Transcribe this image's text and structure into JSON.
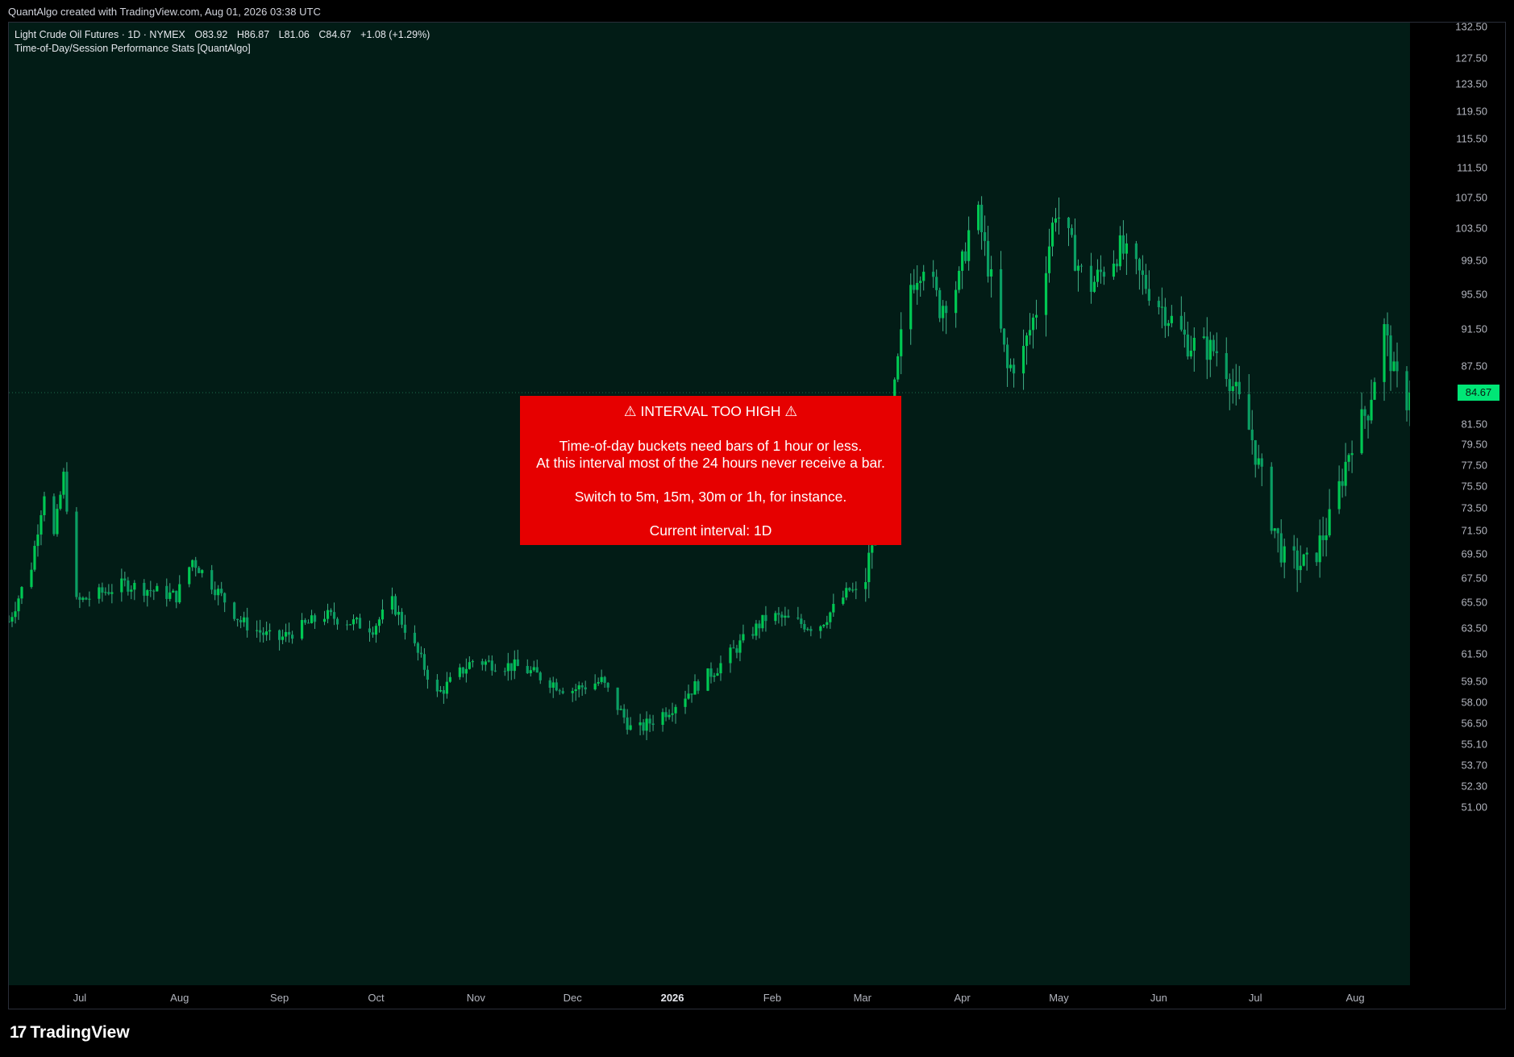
{
  "header": {
    "attribution": "QuantAlgo created with TradingView.com, Aug 01, 2026 03:38 UTC"
  },
  "legend": {
    "symbol": "Light Crude Oil Futures · 1D · NYMEX",
    "open": "O83.92",
    "high": "H86.87",
    "low": "L81.06",
    "close": "C84.67",
    "change": "+1.08 (+1.29%)",
    "indicator": "Time-of-Day/Session Performance Stats [QuantAlgo]"
  },
  "warning": {
    "title": "⚠  INTERVAL TOO HIGH  ⚠",
    "line1": "Time-of-day buckets need bars of 1 hour or less.",
    "line2": "At this interval most of the 24 hours never receive a bar.",
    "line3": "Switch to 5m, 15m, 30m or 1h, for instance.",
    "line4": "Current interval: 1D"
  },
  "brand": {
    "name": "TradingView",
    "logo": "17"
  },
  "colors": {
    "up": "#26a69a",
    "down": "#26a69a",
    "bull_body": "#00c853",
    "bear_body": "#0a9e63",
    "background": "#021c16",
    "price_label": "#00e676",
    "warning_bg": "#e60000"
  },
  "chart_data": {
    "type": "candlestick",
    "current_price": "84.67",
    "y_ticks": [
      "132.50",
      "127.50",
      "123.50",
      "119.50",
      "115.50",
      "111.50",
      "107.50",
      "103.50",
      "99.50",
      "95.50",
      "91.50",
      "87.50",
      "81.50",
      "79.50",
      "77.50",
      "75.50",
      "73.50",
      "71.50",
      "69.50",
      "67.50",
      "65.50",
      "63.50",
      "61.50",
      "59.50",
      "58.00",
      "56.50",
      "55.10",
      "53.70",
      "52.30",
      "51.00"
    ],
    "x_ticks": [
      {
        "label": "Jul",
        "bold": false
      },
      {
        "label": "Aug",
        "bold": false
      },
      {
        "label": "Sep",
        "bold": false
      },
      {
        "label": "Oct",
        "bold": false
      },
      {
        "label": "Nov",
        "bold": false
      },
      {
        "label": "Dec",
        "bold": false
      },
      {
        "label": "2026",
        "bold": true
      },
      {
        "label": "Feb",
        "bold": false
      },
      {
        "label": "Mar",
        "bold": false
      },
      {
        "label": "Apr",
        "bold": false
      },
      {
        "label": "May",
        "bold": false
      },
      {
        "label": "Jun",
        "bold": false
      },
      {
        "label": "Jul",
        "bold": false
      },
      {
        "label": "Aug",
        "bold": false
      }
    ],
    "y_scale": "log",
    "anchors": [
      [
        "2025-06-09",
        64.0
      ],
      [
        "2025-06-16",
        68.5
      ],
      [
        "2025-06-20",
        75.0
      ],
      [
        "2025-06-23",
        71.0
      ],
      [
        "2025-06-26",
        76.5
      ],
      [
        "2025-06-30",
        65.5
      ],
      [
        "2025-07-15",
        67.0
      ],
      [
        "2025-07-31",
        66.0
      ],
      [
        "2025-08-05",
        69.0
      ],
      [
        "2025-08-20",
        64.0
      ],
      [
        "2025-08-31",
        62.5
      ],
      [
        "2025-09-15",
        64.5
      ],
      [
        "2025-09-30",
        63.5
      ],
      [
        "2025-10-06",
        65.5
      ],
      [
        "2025-10-20",
        58.5
      ],
      [
        "2025-10-31",
        61.0
      ],
      [
        "2025-11-15",
        60.5
      ],
      [
        "2025-11-30",
        58.8
      ],
      [
        "2025-12-10",
        59.5
      ],
      [
        "2025-12-20",
        55.8
      ],
      [
        "2025-12-31",
        57.5
      ],
      [
        "2026-01-15",
        60.5
      ],
      [
        "2026-01-31",
        64.5
      ],
      [
        "2026-02-15",
        63.5
      ],
      [
        "2026-02-25",
        66.5
      ],
      [
        "2026-03-01",
        66.0
      ],
      [
        "2026-03-05",
        72.0
      ],
      [
        "2026-03-10",
        82.0
      ],
      [
        "2026-03-15",
        96.0
      ],
      [
        "2026-03-20",
        99.5
      ],
      [
        "2026-03-25",
        94.0
      ],
      [
        "2026-03-31",
        97.0
      ],
      [
        "2026-04-05",
        107.0
      ],
      [
        "2026-04-10",
        97.0
      ],
      [
        "2026-04-15",
        87.0
      ],
      [
        "2026-04-20",
        89.0
      ],
      [
        "2026-04-25",
        95.0
      ],
      [
        "2026-04-30",
        106.0
      ],
      [
        "2026-05-05",
        101.0
      ],
      [
        "2026-05-10",
        96.0
      ],
      [
        "2026-05-20",
        101.0
      ],
      [
        "2026-05-31",
        95.0
      ],
      [
        "2026-06-10",
        90.0
      ],
      [
        "2026-06-20",
        89.0
      ],
      [
        "2026-06-30",
        80.0
      ],
      [
        "2026-07-05",
        73.5
      ],
      [
        "2026-07-10",
        69.0
      ],
      [
        "2026-07-18",
        68.5
      ],
      [
        "2026-07-25",
        73.0
      ],
      [
        "2026-07-31",
        80.0
      ],
      [
        "2026-08-05",
        83.0
      ],
      [
        "2026-08-10",
        91.5
      ],
      [
        "2026-08-13",
        86.5
      ],
      [
        "2026-08-17",
        83.92
      ],
      [
        "2026-08-18",
        84.67
      ]
    ]
  }
}
